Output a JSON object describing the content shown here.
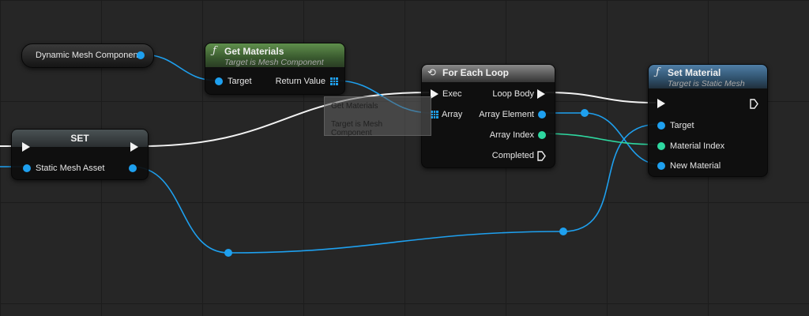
{
  "nodes": {
    "dynamic_mesh": {
      "title": "Dynamic Mesh Component"
    },
    "get_materials": {
      "title": "Get Materials",
      "subtitle": "Target is Mesh Component",
      "function_icon": "ƒ",
      "header_color": "#4a7a3c",
      "pins_in": [
        "Target"
      ],
      "pins_out": [
        "Return Value"
      ]
    },
    "set_var": {
      "title": "SET",
      "pins_in": [
        "Static Mesh Asset"
      ]
    },
    "for_each": {
      "title": "For Each Loop",
      "loop_icon": "loop-icon",
      "pins_in": [
        "Exec",
        "Array"
      ],
      "pins_out": [
        "Loop Body",
        "Array Element",
        "Array Index",
        "Completed"
      ]
    },
    "set_material": {
      "title": "Set Material",
      "subtitle": "Target is Static Mesh",
      "function_icon": "ƒ",
      "header_color": "#3d6a8f",
      "pins_in": [
        "Target",
        "Material Index",
        "New Material"
      ]
    }
  },
  "tooltip": {
    "title": "Get Materials",
    "subtitle": "Target is Mesh Component"
  },
  "colors": {
    "object_pin": "#1ea0ef",
    "integer_pin": "#2ed8a0",
    "exec_wire": "#f2f2f2",
    "background": "#262626"
  }
}
